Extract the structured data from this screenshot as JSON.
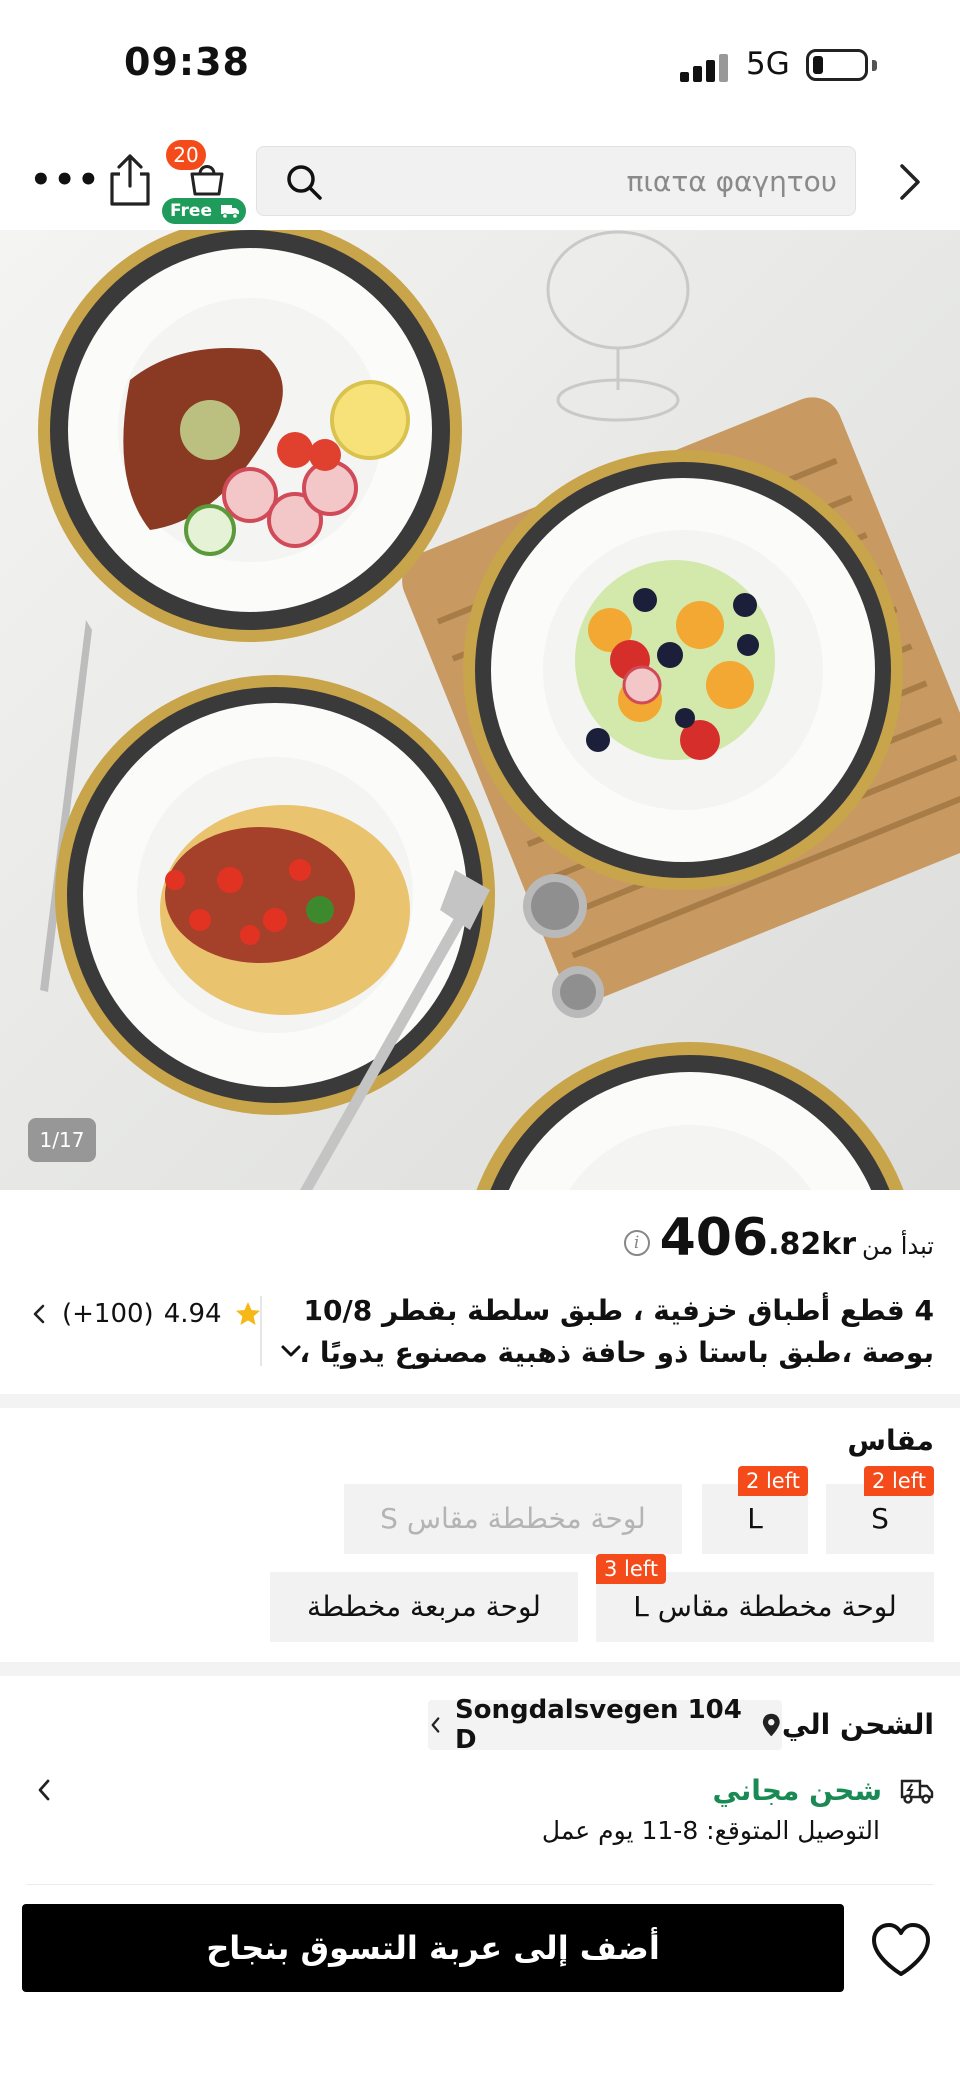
{
  "status_bar": {
    "time": "09:38",
    "network": "5G"
  },
  "nav": {
    "cart_count": "20",
    "free_label": "Free",
    "search_placeholder": "πιατα φαγητου",
    "icons": [
      "more-icon",
      "share-icon",
      "cart-icon",
      "search-icon",
      "forward-icon"
    ]
  },
  "gallery": {
    "counter": "1/17"
  },
  "price": {
    "prefix": "تبدأ من",
    "main": "406",
    "cents": ".82",
    "currency": "kr"
  },
  "product": {
    "title_line1": "4 قطع أطباق خزفية ، طبق سلطة بقطر 10/8",
    "title_line2": "بوصة ،طبق باستا ذو حافة ذهبية مصنوع يدويًا ،",
    "rating": "4.94",
    "review_count": "(+100)"
  },
  "size": {
    "title": "مقاس",
    "options": [
      {
        "label": "S",
        "badge": "2 left"
      },
      {
        "label": "L",
        "badge": "2 left"
      },
      {
        "label": "لوحة مخططة مقاس S",
        "badge": ""
      },
      {
        "label": "لوحة مخططة مقاس L",
        "badge": "3 left"
      },
      {
        "label": "لوحة مربعة مخططة",
        "badge": ""
      }
    ]
  },
  "shipping": {
    "title": "الشحن الي",
    "address": "Songdalsvegen 104 D",
    "free_label": "شحن مجاني",
    "delivery_estimate": "التوصيل المتوقع: 8-11 يوم عمل"
  },
  "actions": {
    "add_to_cart": "أضف إلى عربة التسوق بنجاح"
  },
  "colors": {
    "accent_orange": "#f54b1a",
    "free_green": "#1f9c5c",
    "free_ship_text": "#1a8a55"
  }
}
